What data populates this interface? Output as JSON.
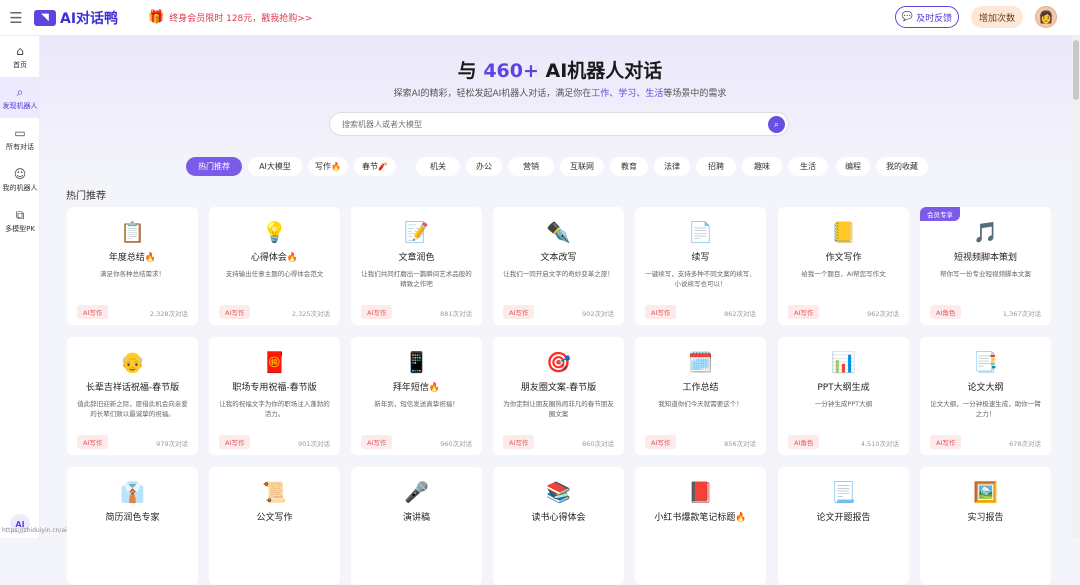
{
  "topbar": {
    "logo_text": "AI对话鸭",
    "promo_text": "终身会员限时 128元，戳我抢购>>",
    "feedback_label": "及时反馈",
    "add_label": "增加次数"
  },
  "sidebar": {
    "items": [
      {
        "label": "首页",
        "icon": "home-icon"
      },
      {
        "label": "发现机器人",
        "icon": "search-icon"
      },
      {
        "label": "所有对话",
        "icon": "chat-icon"
      },
      {
        "label": "我的机器人",
        "icon": "robot-icon"
      },
      {
        "label": "多模型PK",
        "icon": "pk-icon"
      }
    ],
    "ai_badge": "AI",
    "url": "https://zhiduiyin.cn/aibot/320"
  },
  "hero": {
    "title_prefix": "与",
    "title_num": "460+",
    "title_suffix": "AI机器人对话",
    "sub_before": "探索AI的精彩，轻松发起AI机器人对话，满足你在",
    "sub_hl1": "工作",
    "sub_sep1": "、",
    "sub_hl2": "学习",
    "sub_sep2": "、",
    "sub_hl3": "生活",
    "sub_after": "等场景中的需求"
  },
  "search": {
    "placeholder": "搜索机器人或者大模型"
  },
  "tabs": [
    "热门推荐",
    "AI大模型",
    "写作🔥",
    "春节🧨",
    "机关",
    "办公",
    "营销",
    "互联网",
    "教育",
    "法律",
    "招聘",
    "趣味",
    "生活",
    "编程",
    "我的收藏"
  ],
  "section_title": "热门推荐",
  "cards": [
    {
      "title": "年度总结🔥",
      "desc": "满足你各种总结需求！",
      "tag": "AI写作",
      "count": "2,328次对话",
      "icon": "📋"
    },
    {
      "title": "心得体会🔥",
      "desc": "支持输出任意主题的心得体会范文",
      "tag": "AI写作",
      "count": "2,325次对话",
      "icon": "💡"
    },
    {
      "title": "文章润色",
      "desc": "让我们共同打磨出一篇瞬间艺术品般的精致之作吧",
      "tag": "AI写作",
      "count": "881次对话",
      "icon": "📝"
    },
    {
      "title": "文本改写",
      "desc": "让我们一同开启文字的奇妙变革之旅！",
      "tag": "AI写作",
      "count": "902次对话",
      "icon": "✒️"
    },
    {
      "title": "续写",
      "desc": "一键续写，支持多种不同文案的续写、小说续写也可以！",
      "tag": "AI写作",
      "count": "862次对话",
      "icon": "📄"
    },
    {
      "title": "作文写作",
      "desc": "给我一个题目，AI帮您写作文",
      "tag": "AI写作",
      "count": "962次对话",
      "icon": "📒"
    },
    {
      "title": "短视频脚本策划",
      "desc": "帮你写一份专业短视频脚本文案",
      "tag": "AI角色",
      "count": "1,367次对话",
      "icon": "🎵",
      "badge": "会员专享"
    },
    {
      "title": "长辈吉祥话祝福-春节版",
      "desc": "值此辞旧迎新之际，愿借此机会向亲爱的长辈们致以最诚挚的祝福。",
      "tag": "AI写作",
      "count": "979次对话",
      "icon": "👴"
    },
    {
      "title": "职场专用祝福-春节版",
      "desc": "让我的祝福文字为你的职场注入蓬勃的活力。",
      "tag": "AI写作",
      "count": "901次对话",
      "icon": "🧧"
    },
    {
      "title": "拜年短信🔥",
      "desc": "新年到，短信发送真挚祝福！",
      "tag": "AI写作",
      "count": "960次对话",
      "icon": "📱"
    },
    {
      "title": "朋友圈文案-春节版",
      "desc": "为你定制让朋友圈热闹非凡的春节朋友圈文案",
      "tag": "AI写作",
      "count": "860次对话",
      "icon": "🎯"
    },
    {
      "title": "工作总结",
      "desc": "我知道你们今天就需要这个！",
      "tag": "AI写作",
      "count": "856次对话",
      "icon": "🗓️"
    },
    {
      "title": "PPT大纲生成",
      "desc": "一分钟生成PPT大纲",
      "tag": "AI角色",
      "count": "4,510次对话",
      "icon": "📊"
    },
    {
      "title": "论文大纲",
      "desc": "论文大纲，一分钟极速生成，助你一臂之力！",
      "tag": "AI写作",
      "count": "678次对话",
      "icon": "📑"
    },
    {
      "title": "简历润色专家",
      "desc": "",
      "tag": "",
      "count": "",
      "icon": "👔"
    },
    {
      "title": "公文写作",
      "desc": "",
      "tag": "",
      "count": "",
      "icon": "📜"
    },
    {
      "title": "演讲稿",
      "desc": "",
      "tag": "",
      "count": "",
      "icon": "🎤"
    },
    {
      "title": "读书心得体会",
      "desc": "",
      "tag": "",
      "count": "",
      "icon": "📚"
    },
    {
      "title": "小红书爆款笔记标题🔥",
      "desc": "",
      "tag": "",
      "count": "",
      "icon": "📕"
    },
    {
      "title": "论文开题报告",
      "desc": "",
      "tag": "",
      "count": "",
      "icon": "📃"
    },
    {
      "title": "实习报告",
      "desc": "",
      "tag": "",
      "count": "",
      "icon": "🖼️"
    }
  ]
}
